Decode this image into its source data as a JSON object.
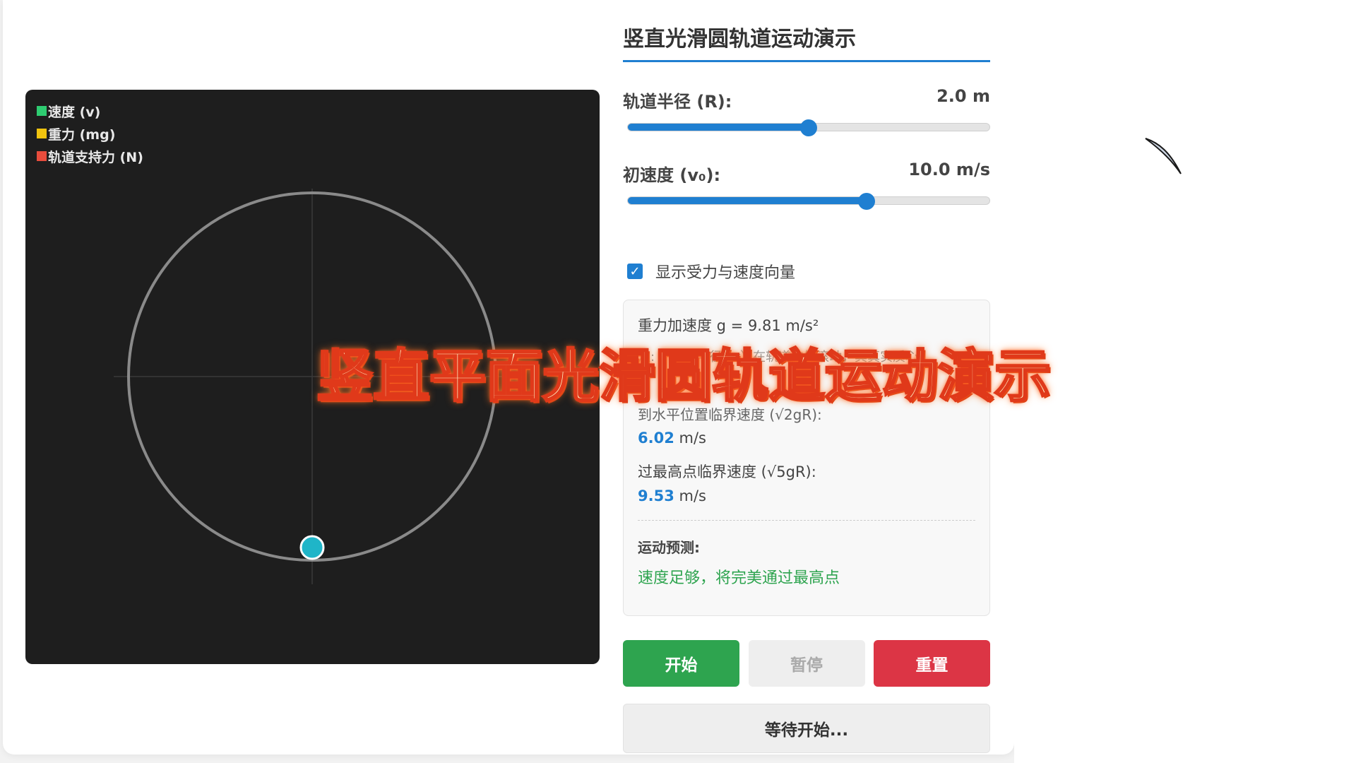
{
  "legend": [
    {
      "label": "速度 (v)",
      "color": "#2ecc71"
    },
    {
      "label": "重力 (mg)",
      "color": "#f1c40f"
    },
    {
      "label": "轨道支持力 (N)",
      "color": "#e74c3c"
    }
  ],
  "panel": {
    "title": "竖直光滑圆轨道运动演示",
    "radius": {
      "label": "轨道半径 (R):",
      "value": "2.0 m",
      "fraction": 0.5
    },
    "velocity": {
      "label": "初速度 (v₀):",
      "value": "10.0 m/s",
      "fraction": 0.66
    },
    "show_vectors": {
      "label": "显示受力与速度向量",
      "checked": true
    },
    "info": {
      "gravity": "重力加速度 g = 9.81 m/s²",
      "note": "注: 小球（半径为r）在轨道内侧滚动，其真实质心",
      "horizontal_label": "到水平位置临界速度 (√2gR):",
      "horizontal_value": "6.02",
      "top_label": "过最高点临界速度 (√5gR):",
      "top_value": "9.53",
      "unit": "m/s",
      "prediction_label": "运动预测:",
      "prediction_text": "速度足够，将完美通过最高点"
    },
    "buttons": {
      "start": "开始",
      "pause": "暂停",
      "reset": "重置"
    },
    "status": "等待开始..."
  },
  "overlay": {
    "caption": "竖直平面光滑圆轨道运动演示"
  },
  "colors": {
    "accent": "#1f7fd1",
    "start": "#2ea44f",
    "reset": "#dc3545",
    "ball": "#1fb5c8"
  }
}
